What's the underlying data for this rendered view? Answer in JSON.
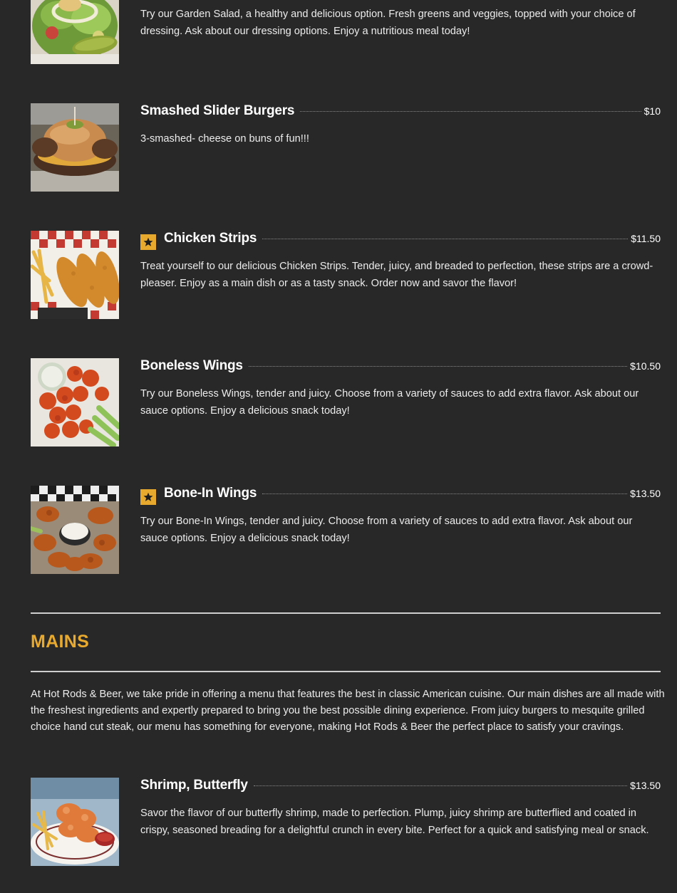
{
  "items_top": [
    {
      "name": "",
      "price": "",
      "featured": false,
      "description": "Try our Garden Salad, a healthy and delicious option. Fresh greens and veggies, topped with your choice of dressing. Ask about our dressing options. Enjoy a nutritious meal today!",
      "image_icon": "garden-salad-photo"
    },
    {
      "name": "Smashed Slider Burgers",
      "price": "$10",
      "featured": false,
      "description": "3-smashed- cheese on buns of fun!!!",
      "image_icon": "slider-burger-photo"
    },
    {
      "name": "Chicken Strips",
      "price": "$11.50",
      "featured": true,
      "description": "Treat yourself to our delicious Chicken Strips. Tender, juicy, and breaded to perfection, these strips are a crowd-pleaser. Enjoy as a main dish or as a tasty snack. Order now and savor the flavor!",
      "image_icon": "chicken-strips-photo"
    },
    {
      "name": "Boneless Wings",
      "price": "$10.50",
      "featured": false,
      "description": "Try our Boneless Wings, tender and juicy. Choose from a variety of sauces to add extra flavor. Ask about our sauce options. Enjoy a delicious snack today!",
      "image_icon": "boneless-wings-photo"
    },
    {
      "name": "Bone-In Wings",
      "price": "$13.50",
      "featured": true,
      "description": "Try our Bone-In Wings, tender and juicy. Choose from a variety of sauces to add extra flavor. Ask about our sauce options. Enjoy a delicious snack today!",
      "image_icon": "bone-in-wings-photo"
    }
  ],
  "mains": {
    "title": "MAINS",
    "intro": "At Hot Rods & Beer, we take pride in offering a menu that features the best in classic American cuisine. Our main dishes are all made with the freshest ingredients and expertly prepared to bring you the best possible dining experience. From juicy burgers to mesquite grilled choice hand cut steak, our menu has something for everyone, making Hot Rods & Beer the perfect place to satisfy your cravings.",
    "items": [
      {
        "name": "Shrimp, Butterfly",
        "price": "$13.50",
        "featured": false,
        "description": "Savor the flavor of our butterfly shrimp, made to perfection. Plump, juicy shrimp are butterflied and coated in crispy, seasoned breading for a delightful crunch in every bite. Perfect for a quick and satisfying meal or snack.",
        "image_icon": "butterfly-shrimp-photo"
      }
    ]
  },
  "colors": {
    "background": "#282828",
    "accent": "#e8a92f",
    "text": "#ffffff",
    "rule": "#cfcfcf"
  }
}
